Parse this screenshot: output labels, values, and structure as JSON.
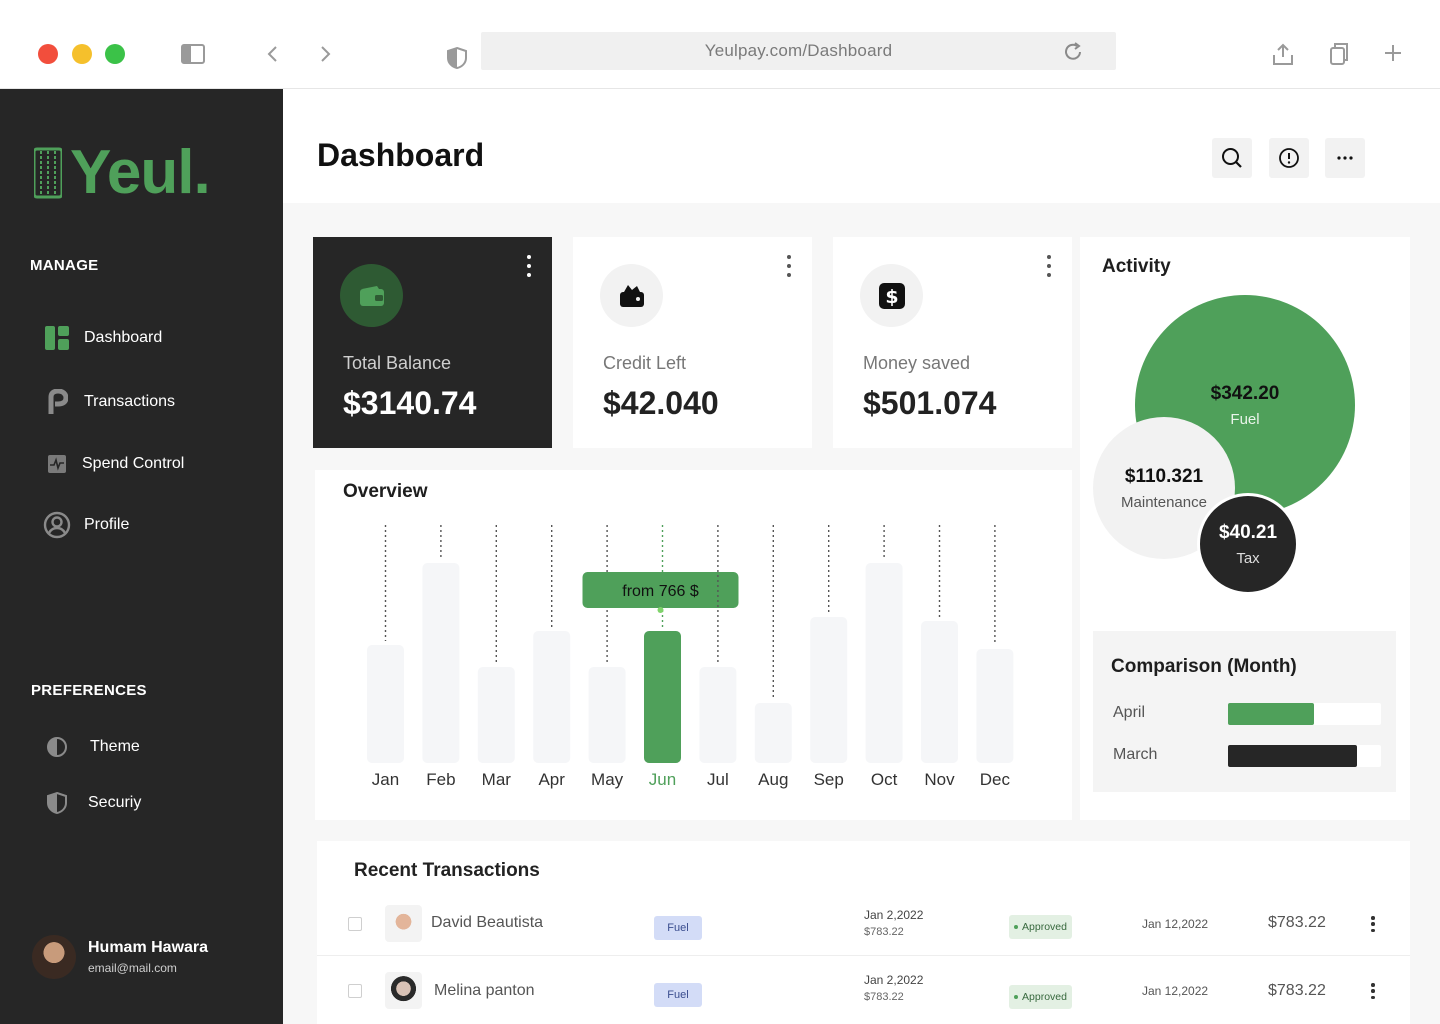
{
  "browser": {
    "url": "Yeulpay.com/Dashboard"
  },
  "brand": {
    "name": "Yeul.",
    "accent": "#4fa05a"
  },
  "sidebar": {
    "manage_label": "MANAGE",
    "manage_items": [
      {
        "label": "Dashboard",
        "icon": "dashboard-icon"
      },
      {
        "label": "Transactions",
        "icon": "transactions-icon"
      },
      {
        "label": "Spend Control",
        "icon": "spend-control-icon"
      },
      {
        "label": "Profile",
        "icon": "profile-icon"
      }
    ],
    "preferences_label": "PREFERENCES",
    "preference_items": [
      {
        "label": "Theme",
        "icon": "theme-icon"
      },
      {
        "label": "Securiy",
        "icon": "shield-icon"
      }
    ],
    "user": {
      "name": "Humam Hawara",
      "email": "email@mail.com"
    }
  },
  "header": {
    "title": "Dashboard"
  },
  "stats": [
    {
      "label": "Total Balance",
      "value": "$3140.74",
      "icon": "wallet-icon"
    },
    {
      "label": "Credit Left",
      "value": "$42.040",
      "icon": "purse-icon"
    },
    {
      "label": "Money saved",
      "value": "$501.074",
      "icon": "dollar-icon"
    }
  ],
  "overview": {
    "title": "Overview",
    "tooltip": "from 766 $",
    "highlight_color": "#4fa05a",
    "chart_data": {
      "type": "bar",
      "categories": [
        "Jan",
        "Feb",
        "Mar",
        "Apr",
        "May",
        "Jun",
        "Jul",
        "Aug",
        "Sep",
        "Oct",
        "Nov",
        "Dec"
      ],
      "values": [
        59,
        100,
        48,
        66,
        48,
        66,
        48,
        30,
        73,
        100,
        71,
        57
      ],
      "highlight_index": 5,
      "ylim": [
        0,
        100
      ]
    }
  },
  "activity": {
    "title": "Activity",
    "bubbles": [
      {
        "value": "$342.20",
        "label": "Fuel"
      },
      {
        "value": "$110.321",
        "label": "Maintenance"
      },
      {
        "value": "$40.21",
        "label": "Tax"
      }
    ],
    "comparison": {
      "title": "Comparison (Month)",
      "rows": [
        {
          "label": "April",
          "fraction": 0.56,
          "color": "#4fa05a"
        },
        {
          "label": "March",
          "fraction": 0.84,
          "color": "#262626"
        }
      ]
    }
  },
  "transactions": {
    "title": "Recent Transactions",
    "rows": [
      {
        "name": "David Beautista",
        "tag": "Fuel",
        "date": "Jan 2,2022",
        "date_amount": "$783.22",
        "status": "Approved",
        "date2": "Jan 12,2022",
        "amount": "$783.22"
      },
      {
        "name": "Melina panton",
        "tag": "Fuel",
        "date": "Jan 2,2022",
        "date_amount": "$783.22",
        "status": "Approved",
        "date2": "Jan 12,2022",
        "amount": "$783.22"
      }
    ]
  }
}
